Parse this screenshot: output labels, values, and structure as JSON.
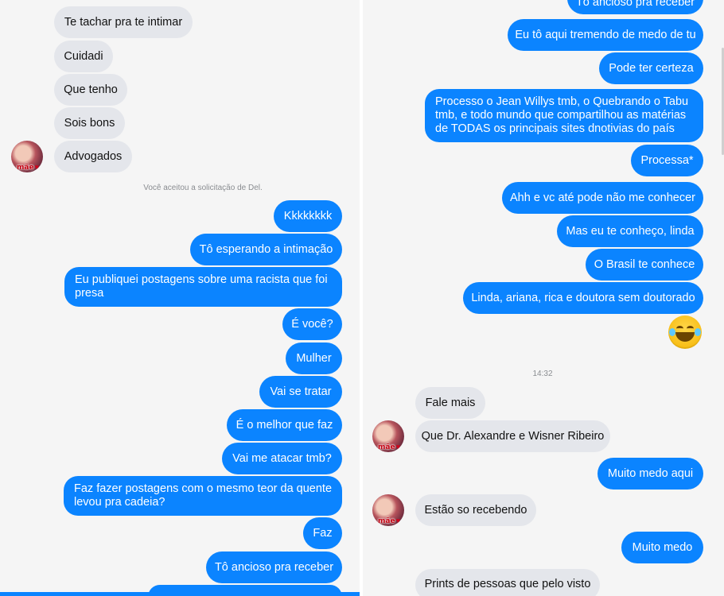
{
  "left": {
    "received": [
      "Te tachar pra te intimar",
      "Cuidadi",
      "Que tenho",
      "Sois bons",
      "Advogados"
    ],
    "avatar_badge": "mãe",
    "notice": "Você aceitou a solicitação de Del.",
    "sent": [
      "Kkkkkkkk",
      "Tô esperando a intimação",
      "Eu publiquei postagens sobre uma racista que foi presa",
      "É você?",
      "Mulher",
      "Vai se tratar",
      "É o melhor que faz",
      "Vai me atacar tmb?",
      "Faz fazer postagens com o mesmo teor da quente levou pra cadeia?",
      "Faz",
      "Tô ancioso pra receber"
    ]
  },
  "right": {
    "sent_top": [
      "Tô ancioso pra receber",
      "Eu tô aqui tremendo de medo de tu",
      "Pode ter certeza",
      "Processo o Jean Willys tmb, o Quebrando o Tabu tmb, e todo mundo que compartilhou as matérias de TODAS os principais sites dnotivias do país",
      "Processa*",
      "Ahh e vc até pode não me conhecer",
      "Mas eu te conheço, linda",
      "O Brasil te conhece",
      "Linda, ariana, rica e doutora sem doutorado"
    ],
    "emoji": "laughing-tears",
    "timestamp": "14:32",
    "received": [
      "Fale mais",
      "Que Dr. Alexandre e Wisner Ribeiro",
      "Estão so recebendo",
      "Prints de pessoas que pelo visto"
    ],
    "sent_bottom": [
      "Muito medo aqui",
      "Muito medo"
    ],
    "avatar_badge": "mãe"
  },
  "colors": {
    "outgoing": "#0b84ff",
    "incoming": "#e4e6eb",
    "background": "#f5f5f5"
  }
}
